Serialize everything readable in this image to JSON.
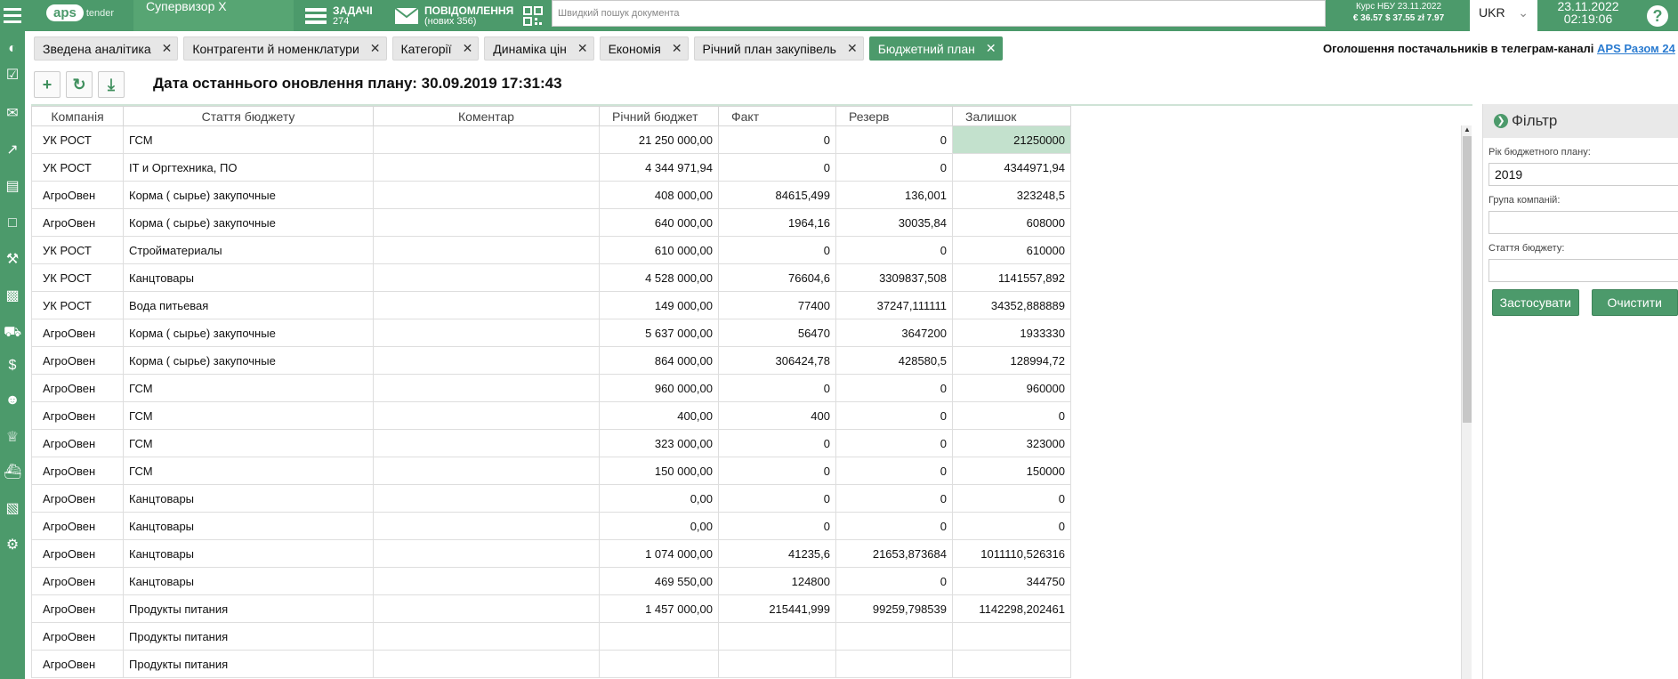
{
  "header": {
    "logo_text": "aps",
    "logo_sub": "tender",
    "role": "Супервизор Х",
    "tasks_label": "ЗАДАЧІ",
    "tasks_count": "274",
    "messages_label": "ПОВІДОМЛЕННЯ",
    "messages_sub": "(нових 356)",
    "search_placeholder": "Швидкий пошук документа",
    "rate_title": "Курс НБУ 23.11.2022",
    "rate_values": "€ 36.57  $ 37.55  zł 7.97",
    "language": "UKR",
    "date": "23.11.2022",
    "time": "02:19:06",
    "help": "?"
  },
  "sidebar_icons": [
    "pie-chart-icon",
    "calendar-check-icon",
    "chat-icon",
    "trend-icon",
    "calendar-icon",
    "document-icon",
    "gavel-icon",
    "file-icon",
    "truck-icon",
    "dollar-icon",
    "users-icon",
    "trophy-icon",
    "ship-icon",
    "book-icon",
    "gears-icon"
  ],
  "tabs": [
    {
      "label": "Зведена аналітика"
    },
    {
      "label": "Контрагенти й номенклатури"
    },
    {
      "label": "Категорії"
    },
    {
      "label": "Динаміка цін"
    },
    {
      "label": "Економія"
    },
    {
      "label": "Річний план закупівель"
    },
    {
      "label": "Бюджетний план",
      "active": true
    }
  ],
  "announcement": {
    "text": "Оголошення постачальників в телеграм-каналі ",
    "link": "APS Разом 24"
  },
  "plan_date": "Дата останнього оновлення плану: 30.09.2019 17:31:43",
  "grid": {
    "columns": [
      "Компанія",
      "Стаття бюджету",
      "Коментар",
      "Річний бюджет",
      "Факт",
      "Резерв",
      "Залишок"
    ],
    "rows": [
      [
        "УК РОСТ",
        "ГСМ",
        "",
        "21 250 000,00",
        "0",
        "0",
        "21250000"
      ],
      [
        "УК РОСТ",
        "IT и Оргтехника, ПО",
        "",
        "4 344 971,94",
        "0",
        "0",
        "4344971,94"
      ],
      [
        "АгроОвен",
        "Корма ( сырье) закупочные",
        "",
        "408 000,00",
        "84615,499",
        "136,001",
        "323248,5"
      ],
      [
        "АгроОвен",
        "Корма ( сырье) закупочные",
        "",
        "640 000,00",
        "1964,16",
        "30035,84",
        "608000"
      ],
      [
        "УК РОСТ",
        "Стройматериалы",
        "",
        "610 000,00",
        "0",
        "0",
        "610000"
      ],
      [
        "УК РОСТ",
        "Канцтовары",
        "",
        "4 528 000,00",
        "76604,6",
        "3309837,508",
        "1141557,892"
      ],
      [
        "УК РОСТ",
        "Вода питьевая",
        "",
        "149 000,00",
        "77400",
        "37247,111111",
        "34352,888889"
      ],
      [
        "АгроОвен",
        "Корма ( сырье) закупочные",
        "",
        "5 637 000,00",
        "56470",
        "3647200",
        "1933330"
      ],
      [
        "АгроОвен",
        "Корма ( сырье) закупочные",
        "",
        "864 000,00",
        "306424,78",
        "428580,5",
        "128994,72"
      ],
      [
        "АгроОвен",
        "ГСМ",
        "",
        "960 000,00",
        "0",
        "0",
        "960000"
      ],
      [
        "АгроОвен",
        "ГСМ",
        "",
        "400,00",
        "400",
        "0",
        "0"
      ],
      [
        "АгроОвен",
        "ГСМ",
        "",
        "323 000,00",
        "0",
        "0",
        "323000"
      ],
      [
        "АгроОвен",
        "ГСМ",
        "",
        "150 000,00",
        "0",
        "0",
        "150000"
      ],
      [
        "АгроОвен",
        "Канцтовары",
        "",
        "0,00",
        "0",
        "0",
        "0"
      ],
      [
        "АгроОвен",
        "Канцтовары",
        "",
        "0,00",
        "0",
        "0",
        "0"
      ],
      [
        "АгроОвен",
        "Канцтовары",
        "",
        "1 074 000,00",
        "41235,6",
        "21653,873684",
        "1011110,526316"
      ],
      [
        "АгроОвен",
        "Канцтовары",
        "",
        "469 550,00",
        "124800",
        "0",
        "344750"
      ],
      [
        "АгроОвен",
        "Продукты питания",
        "",
        "1 457 000,00",
        "215441,999",
        "99259,798539",
        "1142298,202461"
      ],
      [
        "АгроОвен",
        "Продукты питания",
        "",
        "",
        "",
        "",
        ""
      ],
      [
        "АгроОвен",
        "Продукты питания",
        "",
        "",
        "",
        "",
        ""
      ]
    ]
  },
  "filter": {
    "title": "Фільтр",
    "year_label": "Рік бюджетного плану:",
    "year_value": "2019",
    "group_label": "Група компаній:",
    "group_value": "",
    "item_label": "Стаття бюджету:",
    "item_value": "",
    "apply": "Застосувати",
    "clear": "Очистити"
  }
}
